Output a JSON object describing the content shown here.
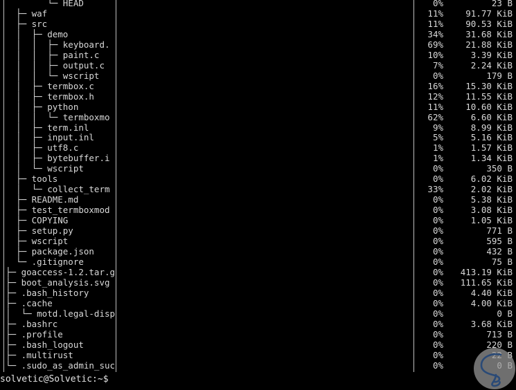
{
  "terminal": {
    "background_color": "#000000",
    "foreground_color": "#d9d9d9",
    "rule_color": "#bfbfbf",
    "prompt": "solvetic@Solvetic:~$"
  },
  "columns": {
    "tree_header": "",
    "percent_header": "",
    "size_header": ""
  },
  "rows": [
    {
      "tree": "        └─ HEAD",
      "percent": "0%",
      "size": "23 B"
    },
    {
      "tree": "  ├─ waf",
      "percent": "11%",
      "size": "91.77 KiB"
    },
    {
      "tree": "  ├─ src",
      "percent": "11%",
      "size": "90.53 KiB"
    },
    {
      "tree": "  │  ├─ demo",
      "percent": "34%",
      "size": "31.68 KiB"
    },
    {
      "tree": "  │  │  ├─ keyboard.",
      "percent": "69%",
      "size": "21.88 KiB"
    },
    {
      "tree": "  │  │  ├─ paint.c",
      "percent": "10%",
      "size": "3.39 KiB"
    },
    {
      "tree": "  │  │  ├─ output.c",
      "percent": "7%",
      "size": "2.24 KiB"
    },
    {
      "tree": "  │  │  └─ wscript",
      "percent": "0%",
      "size": "179 B"
    },
    {
      "tree": "  │  ├─ termbox.c",
      "percent": "16%",
      "size": "15.30 KiB"
    },
    {
      "tree": "  │  ├─ termbox.h",
      "percent": "12%",
      "size": "11.55 KiB"
    },
    {
      "tree": "  │  ├─ python",
      "percent": "11%",
      "size": "10.60 KiB"
    },
    {
      "tree": "  │  │  └─ termboxmo",
      "percent": "62%",
      "size": "6.60 KiB"
    },
    {
      "tree": "  │  ├─ term.inl",
      "percent": "9%",
      "size": "8.99 KiB"
    },
    {
      "tree": "  │  ├─ input.inl",
      "percent": "5%",
      "size": "5.16 KiB"
    },
    {
      "tree": "  │  ├─ utf8.c",
      "percent": "1%",
      "size": "1.57 KiB"
    },
    {
      "tree": "  │  ├─ bytebuffer.i",
      "percent": "1%",
      "size": "1.34 KiB"
    },
    {
      "tree": "  │  └─ wscript",
      "percent": "0%",
      "size": "350 B"
    },
    {
      "tree": "  ├─ tools",
      "percent": "0%",
      "size": "6.02 KiB"
    },
    {
      "tree": "  │  └─ collect_term",
      "percent": "33%",
      "size": "2.02 KiB"
    },
    {
      "tree": "  ├─ README.md",
      "percent": "0%",
      "size": "5.38 KiB"
    },
    {
      "tree": "  ├─ test_termboxmod",
      "percent": "0%",
      "size": "3.08 KiB"
    },
    {
      "tree": "  ├─ COPYING",
      "percent": "0%",
      "size": "1.05 KiB"
    },
    {
      "tree": "  ├─ setup.py",
      "percent": "0%",
      "size": "771 B"
    },
    {
      "tree": "  ├─ wscript",
      "percent": "0%",
      "size": "595 B"
    },
    {
      "tree": "  ├─ package.json",
      "percent": "0%",
      "size": "432 B"
    },
    {
      "tree": "  └─ .gitignore",
      "percent": "0%",
      "size": "75 B"
    },
    {
      "tree": "├─ goaccess-1.2.tar.g",
      "percent": "0%",
      "size": "413.19 KiB"
    },
    {
      "tree": "├─ boot_analysis.svg",
      "percent": "0%",
      "size": "111.65 KiB"
    },
    {
      "tree": "├─ .bash_history",
      "percent": "0%",
      "size": "4.40 KiB"
    },
    {
      "tree": "├─ .cache",
      "percent": "0%",
      "size": "4.00 KiB"
    },
    {
      "tree": "│  └─ motd.legal-disp",
      "percent": "0%",
      "size": "0 B"
    },
    {
      "tree": "├─ .bashrc",
      "percent": "0%",
      "size": "3.68 KiB"
    },
    {
      "tree": "├─ .profile",
      "percent": "0%",
      "size": "713 B"
    },
    {
      "tree": "├─ .bash_logout",
      "percent": "0%",
      "size": "220 B"
    },
    {
      "tree": "├─ .multirust",
      "percent": "0%",
      "size": "22 B"
    },
    {
      "tree": "└─ .sudo_as_admin_suc",
      "percent": "0%",
      "size": "0 B"
    }
  ],
  "watermark": {
    "name": "solvetic-logo",
    "circle_color": "#9a9a9a",
    "mark_color": "#2a4a77"
  }
}
